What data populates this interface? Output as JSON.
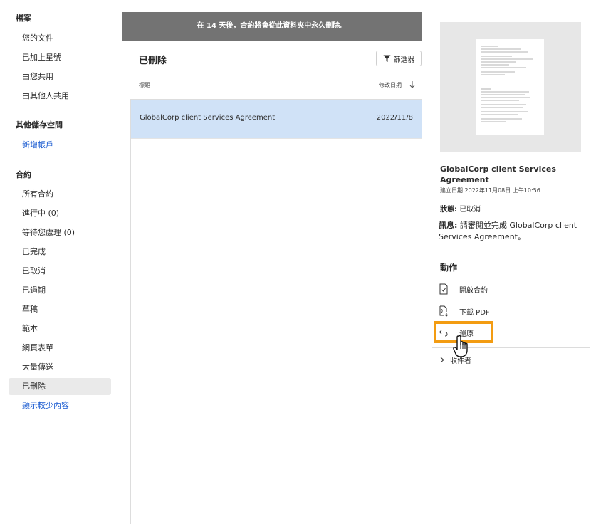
{
  "sidebar": {
    "files_header": "檔案",
    "files_items": [
      "您的文件",
      "已加上星號",
      "由您共用",
      "由其他人共用"
    ],
    "storage_header": "其他儲存空間",
    "add_account": "新增帳戶",
    "agreements_header": "合約",
    "agreement_items": [
      "所有合約",
      "進行中 (0)",
      "等待您處理 (0)",
      "已完成",
      "已取消",
      "已過期",
      "草稿",
      "範本",
      "網頁表單",
      "大量傳送",
      "已刪除"
    ],
    "show_less": "顯示較少內容"
  },
  "banner": "在 14 天後，合約將會從此資料夾中永久刪除。",
  "list": {
    "title": "已刪除",
    "filter_label": "篩選器",
    "col_title": "標題",
    "col_modified": "修改日期",
    "rows": [
      {
        "title": "GlobalCorp client Services Agreement",
        "date": "2022/11/8"
      }
    ]
  },
  "detail": {
    "title": "GlobalCorp client Services Agreement",
    "created": "建立日期 2022年11月08日 上午10:56",
    "status_label": "狀態:",
    "status_value": "已取消",
    "message_label": "訊息:",
    "message_value": "請審閱並完成 GlobalCorp client Services Agreement。",
    "actions_title": "動作",
    "actions": [
      "開啟合約",
      "下載 PDF",
      "還原"
    ],
    "recipients": "收件者"
  },
  "colors": {
    "highlight": "#f39c12",
    "selected_row": "#d0e2f7",
    "banner": "#737373",
    "link": "#1a5bd1"
  }
}
